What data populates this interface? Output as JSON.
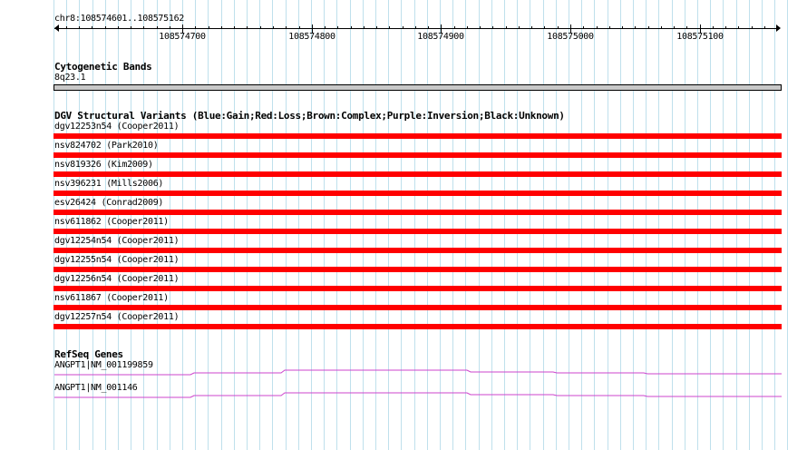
{
  "ruler": {
    "location": "chr8:108574601..108575162",
    "ticks": [
      "108574700",
      "108574800",
      "108574900",
      "108575000",
      "108575100"
    ]
  },
  "cytobands": {
    "title": "Cytogenetic Bands",
    "band": "8q23.1",
    "band_color": "#c8c8c8"
  },
  "dgv": {
    "title": "DGV Structural Variants (Blue:Gain;Red:Loss;Brown:Complex;Purple:Inversion;Black:Unknown)",
    "loss_color": "#ff0000",
    "variants": [
      {
        "label": "dgv12253n54 (Cooper2011)"
      },
      {
        "label": "nsv824702 (Park2010)"
      },
      {
        "label": "nsv819326 (Kim2009)"
      },
      {
        "label": "nsv396231 (Mills2006)"
      },
      {
        "label": "esv26424 (Conrad2009)"
      },
      {
        "label": "nsv611862 (Cooper2011)"
      },
      {
        "label": "dgv12254n54 (Cooper2011)"
      },
      {
        "label": "dgv12255n54 (Cooper2011)"
      },
      {
        "label": "dgv12256n54 (Cooper2011)"
      },
      {
        "label": "nsv611867 (Cooper2011)"
      },
      {
        "label": "dgv12257n54 (Cooper2011)"
      }
    ]
  },
  "refseq": {
    "title": "RefSeq Genes",
    "gene_color": "#cc44cc",
    "genes": [
      {
        "label": "ANGPT1|NM_001199859"
      },
      {
        "label": "ANGPT1|NM_001146"
      }
    ]
  },
  "grid_color": "#bfe0ec"
}
